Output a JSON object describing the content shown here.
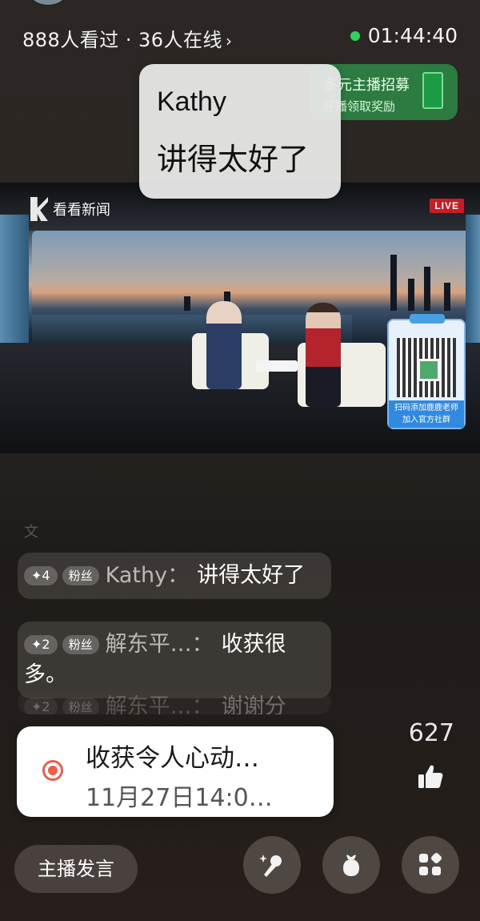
{
  "header": {
    "viewers_seen": "888人看过",
    "separator": "·",
    "online_count": "36人在线",
    "chevron": "›",
    "live_timer": "01:44:40",
    "live_dot_color": "#2ed35a"
  },
  "recruit_banner": {
    "title": "多元主播招募",
    "subtitle": "开播领取奖励"
  },
  "bubble": {
    "name": "Kathy",
    "text": "讲得太好了"
  },
  "video": {
    "channel_logo_text": "看看新闻",
    "live_badge": "LIVE",
    "qr_caption_line1": "扫码添加鹿鹿老师",
    "qr_caption_line2": "加入官方社群"
  },
  "chat": {
    "faded_top_text": "文",
    "messages": [
      {
        "level": "✦4",
        "fan_badge": "粉丝",
        "user": "Kathy：",
        "text": "讲得太好了"
      },
      {
        "level": "✦2",
        "fan_badge": "粉丝",
        "user": "解东平…：",
        "text": "收获很多。"
      },
      {
        "level": "✦2",
        "fan_badge": "粉丝",
        "user": "解东平…：",
        "text": "谢谢分"
      }
    ]
  },
  "replay_card": {
    "title": "收获令人心动…",
    "time": "11月27日14:0…",
    "accent": "#f25a4a"
  },
  "likes": {
    "count": "627",
    "icon": "thumbs-up-icon"
  },
  "bottom_bar": {
    "host_speak_label": "主播发言",
    "buttons": [
      "microphone-sparkle-icon",
      "gift-bag-icon",
      "apps-grid-icon"
    ]
  }
}
